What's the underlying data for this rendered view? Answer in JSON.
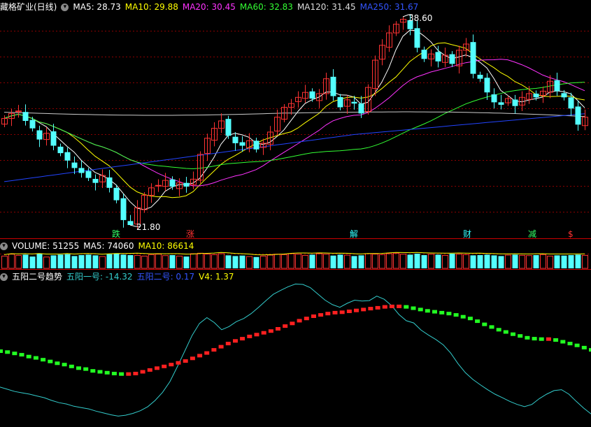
{
  "main": {
    "stock_name": "藏格矿业(日线)",
    "ma": [
      {
        "label": "MA5: 28.73",
        "color": "#ffffff"
      },
      {
        "label": "MA10: 29.88",
        "color": "#ffff00"
      },
      {
        "label": "MA20: 30.45",
        "color": "#ff33ff"
      },
      {
        "label": "MA60: 32.83",
        "color": "#33ff33"
      },
      {
        "label": "MA120: 31.45",
        "color": "#dddddd"
      },
      {
        "label": "MA250: 31.67",
        "color": "#3355ff"
      }
    ],
    "high_label": "38.60",
    "low_label": "21.80"
  },
  "markers": [
    {
      "text": "跌",
      "color": "#33ff66"
    },
    {
      "text": "涨",
      "color": "#ff3333"
    },
    {
      "text": "解",
      "color": "#33ffff"
    },
    {
      "text": "财",
      "color": "#33ffff"
    },
    {
      "text": "减",
      "color": "#33ff66"
    },
    {
      "text": "$",
      "color": "#ff3333"
    }
  ],
  "volume": {
    "label": "VOLUME: 51255",
    "ma5": "MA5: 74060",
    "ma10": "MA10: 86614"
  },
  "indicator": {
    "title": "五阳二号趋势",
    "line1": "五阳一号: -14.32",
    "line2": "五阳二号: 0.17",
    "v4": "V4: 1.37"
  },
  "colors": {
    "up": "#ff3333",
    "down": "#54ffff",
    "grid": "#8b0000",
    "ma5": "#ffffff",
    "ma10": "#ffff00",
    "ma20": "#ff33ff",
    "ma60": "#33ff33",
    "ma120": "#cccccc",
    "ma250": "#2244ff",
    "trend_up": "#ff2020",
    "trend_down": "#22ff22",
    "cyan_line": "#33cccc"
  },
  "chart_data": {
    "type": "candlestick",
    "price_range": [
      21.8,
      38.6
    ],
    "close_path": [
      30.4,
      30.8,
      31.0,
      30.2,
      29.6,
      28.7,
      29.2,
      28.2,
      27.6,
      27.0,
      26.4,
      26.0,
      25.6,
      25.2,
      25.8,
      24.8,
      23.8,
      22.2,
      21.8,
      23.2,
      24.2,
      24.8,
      25.0,
      25.4,
      24.9,
      25.2,
      24.9,
      25.5,
      27.5,
      28.8,
      29.6,
      30.2,
      29.0,
      28.4,
      28.2,
      28.6,
      27.9,
      28.4,
      29.3,
      30.5,
      31.3,
      31.6,
      32.1,
      32.5,
      32.0,
      32.4,
      33.6,
      32.2,
      31.3,
      31.9,
      31.6,
      30.8,
      32.9,
      35.1,
      36.3,
      37.3,
      38.0,
      38.4,
      37.6,
      36.1,
      35.2,
      35.6,
      35.0,
      35.5,
      34.8,
      35.9,
      36.4,
      34.0,
      33.6,
      32.5,
      31.7,
      31.5,
      32.0,
      31.4,
      32.1,
      32.4,
      32.1,
      32.6,
      33.4,
      32.6,
      32.1,
      31.2,
      29.9,
      30.5
    ],
    "volume_series": [
      52,
      60,
      55,
      58,
      50,
      62,
      48,
      55,
      58,
      60,
      52,
      56,
      58,
      55,
      50,
      60,
      62,
      58,
      56,
      55,
      52,
      58,
      60,
      54,
      56,
      52,
      50,
      62,
      64,
      60,
      58,
      62,
      55,
      52,
      54,
      50,
      48,
      52,
      56,
      60,
      58,
      62,
      60,
      55,
      58,
      62,
      60,
      54,
      58,
      56,
      52,
      55,
      62,
      60,
      58,
      62,
      64,
      60,
      58,
      62,
      56,
      60,
      58,
      55,
      62,
      60,
      58,
      55,
      56,
      58,
      55,
      52,
      56,
      58,
      55,
      54,
      56,
      58,
      52,
      55,
      54,
      56,
      58,
      55
    ],
    "trend_series": [
      0.0,
      -0.2,
      -0.5,
      -0.8,
      -1.2,
      -1.5,
      -1.9,
      -2.3,
      -2.7,
      -3.0,
      -3.4,
      -3.8,
      -4.0,
      -4.4,
      -4.6,
      -4.8,
      -5.0,
      -5.1,
      -5.1,
      -5.0,
      -4.6,
      -4.2,
      -3.8,
      -3.4,
      -3.0,
      -2.6,
      -2.2,
      -1.6,
      -1.0,
      -0.4,
      0.3,
      1.0,
      1.7,
      2.3,
      2.8,
      3.3,
      3.7,
      4.1,
      4.5,
      5.0,
      5.6,
      6.2,
      6.8,
      7.3,
      7.8,
      8.1,
      8.4,
      8.6,
      8.7,
      8.9,
      9.1,
      9.3,
      9.5,
      9.7,
      9.9,
      10.0,
      10.0,
      9.9,
      9.6,
      9.3,
      9.0,
      8.8,
      8.6,
      8.4,
      8.1,
      7.7,
      7.3,
      6.7,
      6.0,
      5.4,
      4.8,
      4.3,
      3.8,
      3.4,
      3.0,
      2.8,
      2.7,
      2.7,
      2.5,
      2.1,
      1.7,
      1.3,
      0.8,
      0.3
    ],
    "line1_series": [
      -8,
      -8.5,
      -9,
      -9.3,
      -9.6,
      -10,
      -10.4,
      -11,
      -11.5,
      -11.8,
      -12.3,
      -12.6,
      -12.9,
      -13.4,
      -13.8,
      -14.2,
      -14.5,
      -14.3,
      -13.9,
      -13.3,
      -12.4,
      -11,
      -9.2,
      -6.8,
      -3.5,
      0,
      3.5,
      6.2,
      7.5,
      6.4,
      4.8,
      5.5,
      6.6,
      7.3,
      8.4,
      9.8,
      11.3,
      12.7,
      13.6,
      14.4,
      15.0,
      14.9,
      14.2,
      12.8,
      11.4,
      10.4,
      9.8,
      10.7,
      11.4,
      11.2,
      11.3,
      12.3,
      11.6,
      10.2,
      8.2,
      6.8,
      6.3,
      4.7,
      3.6,
      2.6,
      1.4,
      -0.4,
      -2.8,
      -4.8,
      -6.3,
      -7.5,
      -8.6,
      -9.6,
      -10.4,
      -11.2,
      -11.9,
      -12.4,
      -11.9,
      -10.6,
      -9.6,
      -8.8,
      -8.6,
      -9.6,
      -11.2,
      -12.7,
      -14.0
    ]
  }
}
